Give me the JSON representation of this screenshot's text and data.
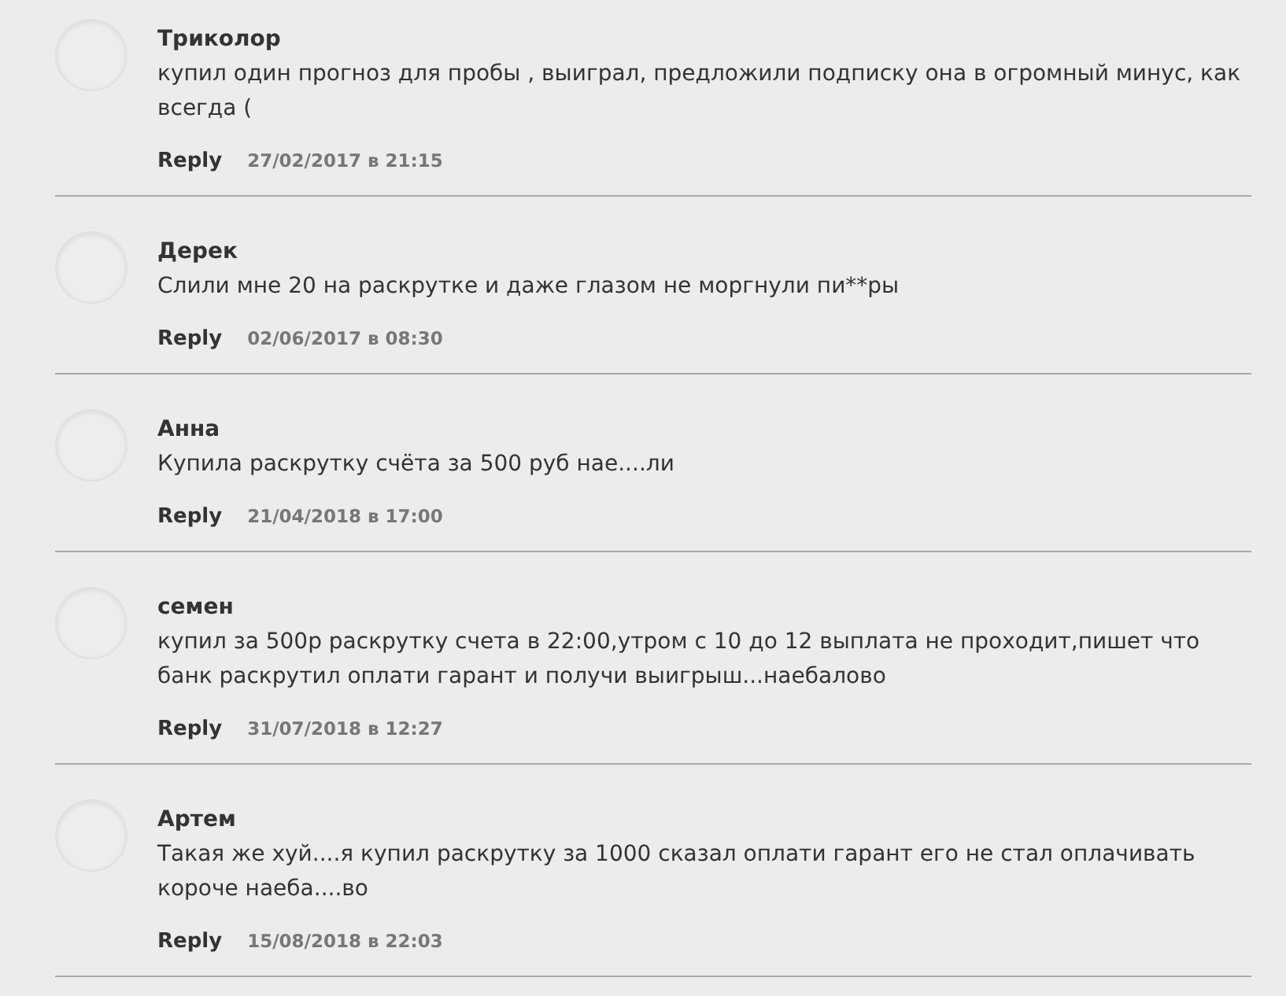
{
  "comments": [
    {
      "author": "Триколор",
      "text": "купил один прогноз для пробы , выиграл, предложили подписку она в огромный минус, как всегда (",
      "reply": "Reply",
      "date": "27/02/2017 в 21:15"
    },
    {
      "author": "Дерек",
      "text": "Слили мне 20 на раскрутке и даже глазом не моргнули пи**ры",
      "reply": "Reply",
      "date": "02/06/2017 в 08:30"
    },
    {
      "author": "Анна",
      "text": "Купила раскрутку счёта за 500 руб нае....ли",
      "reply": "Reply",
      "date": "21/04/2018 в 17:00"
    },
    {
      "author": "семен",
      "text": "купил за 500р раскрутку счета в 22:00,утром с 10 до 12 выплата не проходит,пишет что банк раскрутил оплати гарант и получи выигрыш...наебалово",
      "reply": "Reply",
      "date": "31/07/2018 в 12:27"
    },
    {
      "author": "Артем",
      "text": "Такая же хуй....я купил раскрутку за 1000 сказал оплати гарант его не стал оплачивать короче наеба....во",
      "reply": "Reply",
      "date": "15/08/2018 в 22:03"
    }
  ]
}
